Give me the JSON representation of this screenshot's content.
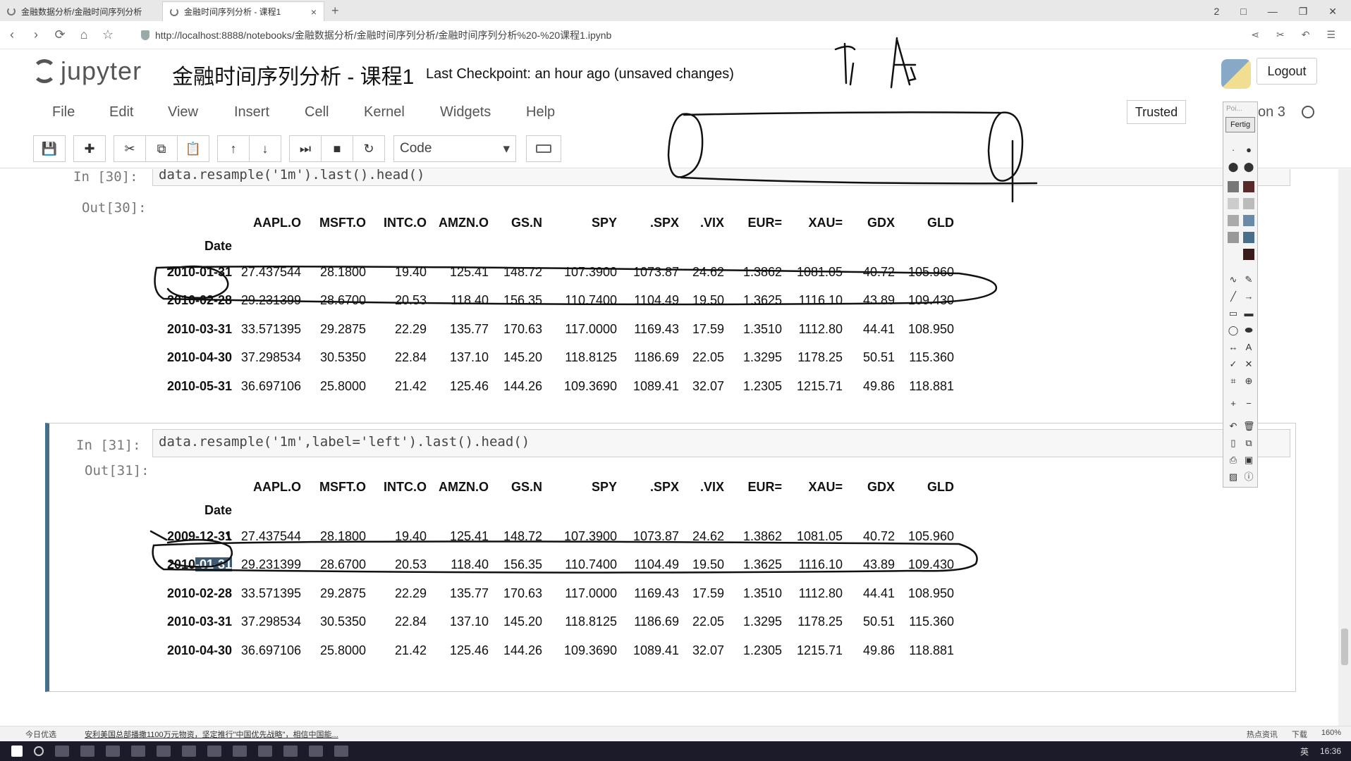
{
  "browser": {
    "tabs": [
      {
        "label": "金融数据分析/金融时间序列分析"
      },
      {
        "label": "金融时间序列分析 - 课程1"
      }
    ],
    "tab_close_glyph": "×",
    "new_tab_glyph": "+",
    "url": "http://localhost:8888/notebooks/金融数据分析/金融时间序列分析/金融时间序列分析%20-%20课程1.ipynb",
    "window_controls": [
      "2",
      "□",
      "—",
      "❐",
      "✕"
    ]
  },
  "jupyter": {
    "logo_text": "jupyter",
    "notebook_title": "金融时间序列分析 - 课程1",
    "checkpoint": "Last Checkpoint: an hour ago (unsaved changes)",
    "logout_label": "Logout",
    "menus": [
      "File",
      "Edit",
      "View",
      "Insert",
      "Cell",
      "Kernel",
      "Widgets",
      "Help"
    ],
    "trusted_label": "Trusted",
    "kernel_name": "on 3",
    "cell_type": "Code"
  },
  "cells": [
    {
      "in_prompt": "In  [30]:",
      "code": "data.resample('1m').last().head()",
      "out_prompt": "Out[30]:",
      "columns": [
        "AAPL.O",
        "MSFT.O",
        "INTC.O",
        "AMZN.O",
        "GS.N",
        "SPY",
        ".SPX",
        ".VIX",
        "EUR=",
        "XAU=",
        "GDX",
        "GLD"
      ],
      "index_name": "Date",
      "rows": [
        {
          "date": "2010-01-31",
          "values": [
            "27.437544",
            "28.1800",
            "19.40",
            "125.41",
            "148.72",
            "107.3900",
            "1073.87",
            "24.62",
            "1.3862",
            "1081.05",
            "40.72",
            "105.960"
          ]
        },
        {
          "date": "2010-02-28",
          "values": [
            "29.231399",
            "28.6700",
            "20.53",
            "118.40",
            "156.35",
            "110.7400",
            "1104.49",
            "19.50",
            "1.3625",
            "1116.10",
            "43.89",
            "109.430"
          ]
        },
        {
          "date": "2010-03-31",
          "values": [
            "33.571395",
            "29.2875",
            "22.29",
            "135.77",
            "170.63",
            "117.0000",
            "1169.43",
            "17.59",
            "1.3510",
            "1112.80",
            "44.41",
            "108.950"
          ]
        },
        {
          "date": "2010-04-30",
          "values": [
            "37.298534",
            "30.5350",
            "22.84",
            "137.10",
            "145.20",
            "118.8125",
            "1186.69",
            "22.05",
            "1.3295",
            "1178.25",
            "50.51",
            "115.360"
          ]
        },
        {
          "date": "2010-05-31",
          "values": [
            "36.697106",
            "25.8000",
            "21.42",
            "125.46",
            "144.26",
            "109.3690",
            "1089.41",
            "32.07",
            "1.2305",
            "1215.71",
            "49.86",
            "118.881"
          ]
        }
      ]
    },
    {
      "in_prompt": "In  [31]:",
      "code": "data.resample('1m',label='left').last().head()",
      "out_prompt": "Out[31]:",
      "columns": [
        "AAPL.O",
        "MSFT.O",
        "INTC.O",
        "AMZN.O",
        "GS.N",
        "SPY",
        ".SPX",
        ".VIX",
        "EUR=",
        "XAU=",
        "GDX",
        "GLD"
      ],
      "index_name": "Date",
      "rows": [
        {
          "date": "2009-12-31",
          "values": [
            "27.437544",
            "28.1800",
            "19.40",
            "125.41",
            "148.72",
            "107.3900",
            "1073.87",
            "24.62",
            "1.3862",
            "1081.05",
            "40.72",
            "105.960"
          ]
        },
        {
          "date_prefix": "2010",
          "date_highlight": "-01-31",
          "values": [
            "29.231399",
            "28.6700",
            "20.53",
            "118.40",
            "156.35",
            "110.7400",
            "1104.49",
            "19.50",
            "1.3625",
            "1116.10",
            "43.89",
            "109.430"
          ]
        },
        {
          "date": "2010-02-28",
          "values": [
            "33.571395",
            "29.2875",
            "22.29",
            "135.77",
            "170.63",
            "117.0000",
            "1169.43",
            "17.59",
            "1.3510",
            "1112.80",
            "44.41",
            "108.950"
          ]
        },
        {
          "date": "2010-03-31",
          "values": [
            "37.298534",
            "30.5350",
            "22.84",
            "137.10",
            "145.20",
            "118.8125",
            "1186.69",
            "22.05",
            "1.3295",
            "1178.25",
            "50.51",
            "115.360"
          ]
        },
        {
          "date": "2010-04-30",
          "values": [
            "36.697106",
            "25.8000",
            "21.42",
            "125.46",
            "144.26",
            "109.3690",
            "1089.41",
            "32.07",
            "1.2305",
            "1215.71",
            "49.86",
            "118.881"
          ]
        }
      ]
    }
  ],
  "annotation_toolbar": {
    "title": "Poi...",
    "done_label": "Fertig"
  },
  "status_bar": {
    "left": "今日优选",
    "news": "安利美国总部播撒1100万元物资，坚定推行\"中国优先战略\"，相信中国能...",
    "right": [
      "热点资讯",
      "下载",
      "160%"
    ]
  },
  "taskbar": {
    "lang": "英",
    "clock": "16:36"
  },
  "colors": {
    "selected_cell_border": "#44708e",
    "selection_highlight": "#3d5a75"
  }
}
